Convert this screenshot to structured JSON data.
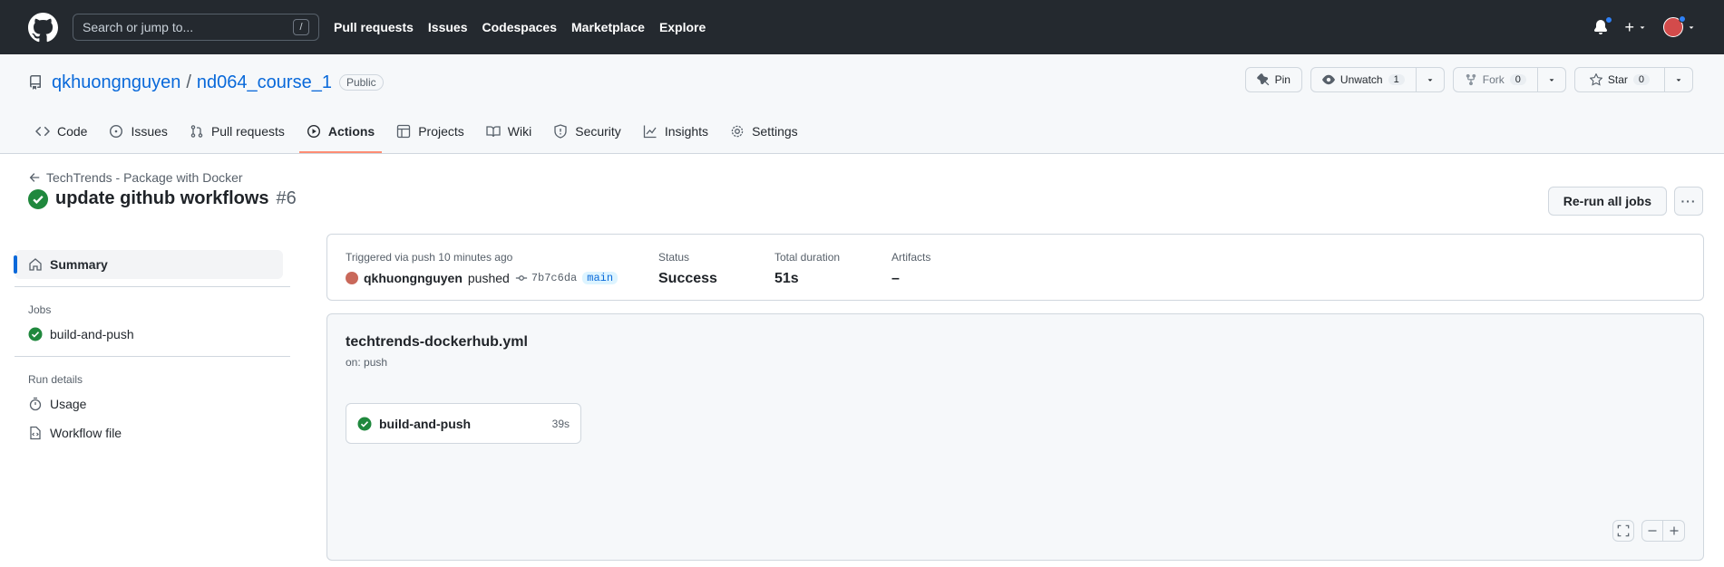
{
  "header": {
    "search_placeholder": "Search or jump to...",
    "search_shortcut": "/",
    "nav": [
      "Pull requests",
      "Issues",
      "Codespaces",
      "Marketplace",
      "Explore"
    ],
    "plus_label": "+"
  },
  "repo": {
    "owner": "qkhuongnguyen",
    "separator": "/",
    "name": "nd064_course_1",
    "visibility": "Public",
    "pin_label": "Pin",
    "unwatch_label": "Unwatch",
    "watch_count": "1",
    "fork_label": "Fork",
    "fork_count": "0",
    "star_label": "Star",
    "star_count": "0"
  },
  "tabs": [
    {
      "label": "Code",
      "icon": "code-icon"
    },
    {
      "label": "Issues",
      "icon": "issue-icon"
    },
    {
      "label": "Pull requests",
      "icon": "pull-request-icon"
    },
    {
      "label": "Actions",
      "icon": "play-icon",
      "active": true
    },
    {
      "label": "Projects",
      "icon": "table-icon"
    },
    {
      "label": "Wiki",
      "icon": "book-icon"
    },
    {
      "label": "Security",
      "icon": "shield-icon"
    },
    {
      "label": "Insights",
      "icon": "graph-icon"
    },
    {
      "label": "Settings",
      "icon": "gear-icon"
    }
  ],
  "run": {
    "back_label": "TechTrends - Package with Docker",
    "title": "update github workflows",
    "number": "#6",
    "rerun_label": "Re-run all jobs",
    "more_label": "···"
  },
  "sidebar": {
    "summary_label": "Summary",
    "jobs_heading": "Jobs",
    "job_label": "build-and-push",
    "run_details_heading": "Run details",
    "usage_label": "Usage",
    "workflow_file_label": "Workflow file"
  },
  "summary": {
    "trigger_label": "Triggered via push 10 minutes ago",
    "user": "qkhuongnguyen",
    "action": "pushed",
    "sha": "7b7c6da",
    "branch": "main",
    "status_label": "Status",
    "status_value": "Success",
    "duration_label": "Total duration",
    "duration_value": "51s",
    "artifacts_label": "Artifacts",
    "artifacts_value": "–"
  },
  "workflow": {
    "file": "techtrends-dockerhub.yml",
    "on": "on: push",
    "job_name": "build-and-push",
    "job_duration": "39s"
  },
  "colors": {
    "header_bg": "#24292f",
    "link": "#0969da",
    "success": "#1f883d",
    "active_tab_underline": "#fd8c73"
  }
}
